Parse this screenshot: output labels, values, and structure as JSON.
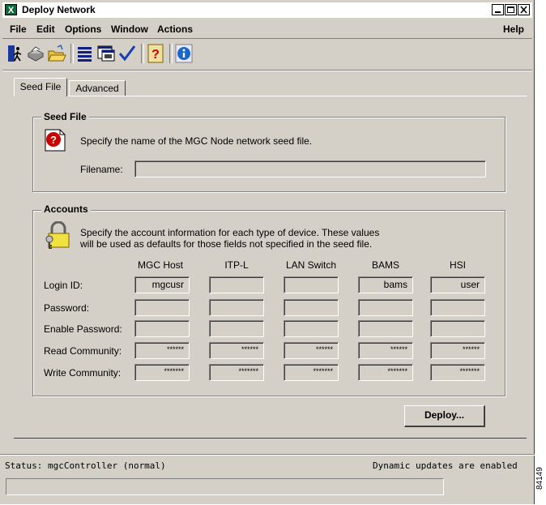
{
  "window": {
    "title": "Deploy Network",
    "app_icon": "X"
  },
  "menu": {
    "file": "File",
    "edit": "Edit",
    "options": "Options",
    "window": "Window",
    "actions": "Actions",
    "help": "Help"
  },
  "tabs": [
    {
      "label": "Seed File",
      "active": true
    },
    {
      "label": "Advanced",
      "active": false
    }
  ],
  "seed_file": {
    "title": "Seed File",
    "description": "Specify the name of the MGC Node network seed file.",
    "filename_label": "Filename:",
    "filename_value": ""
  },
  "accounts": {
    "title": "Accounts",
    "description_line1": "Specify the account information for each type of device.  These values",
    "description_line2": "will be used as defaults for those fields not specified in the seed file.",
    "columns": [
      "MGC Host",
      "ITP-L",
      "LAN Switch",
      "BAMS",
      "HSI"
    ],
    "rows": [
      {
        "label": "Login ID:",
        "values": [
          "mgcusr",
          "",
          "",
          "bams",
          "user"
        ]
      },
      {
        "label": "Password:",
        "values": [
          "",
          "",
          "",
          "",
          ""
        ]
      },
      {
        "label": "Enable Password:",
        "values": [
          "",
          "",
          "",
          "",
          ""
        ]
      },
      {
        "label": "Read Community:",
        "values": [
          "******",
          "******",
          "******",
          "******",
          "******"
        ]
      },
      {
        "label": "Write Community:",
        "values": [
          "*******",
          "*******",
          "*******",
          "*******",
          "*******"
        ]
      }
    ]
  },
  "deploy_button": "Deploy...",
  "status": {
    "left": "Status: mgcController (normal)",
    "right": "Dynamic updates are enabled"
  },
  "figure_number": "84149",
  "colors": {
    "background": "#d4d0c8",
    "help_icon": "#cc0000",
    "info_icon": "#1a66cc"
  }
}
